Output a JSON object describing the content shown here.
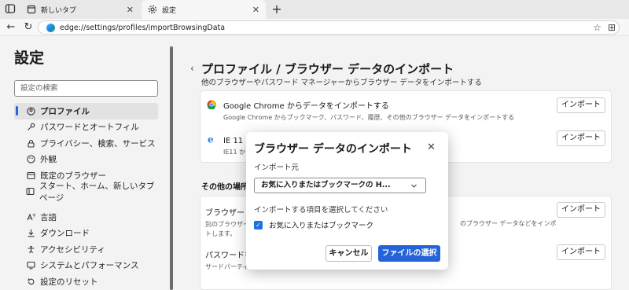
{
  "browser": {
    "tabs": [
      {
        "label": "新しいタブ",
        "icon": "page-icon"
      },
      {
        "label": "設定",
        "icon": "gear-icon"
      }
    ],
    "address": "edge://settings/profiles/importBrowsingData"
  },
  "sidebar": {
    "title": "設定",
    "search_placeholder": "設定の検索",
    "items": [
      {
        "label": "プロファイル",
        "icon": "profile-icon"
      },
      {
        "label": "パスワードとオートフィル",
        "icon": "key-icon"
      },
      {
        "label": "プライバシー、検索、サービス",
        "icon": "lock-icon"
      },
      {
        "label": "外観",
        "icon": "appearance-icon"
      },
      {
        "label": "既定のブラウザー",
        "icon": "browser-icon"
      },
      {
        "label": "スタート、ホーム、新しいタブ ページ",
        "icon": "home-icon"
      },
      {
        "label": "言語",
        "icon": "language-icon"
      },
      {
        "label": "ダウンロード",
        "icon": "download-icon"
      },
      {
        "label": "アクセシビリティ",
        "icon": "accessibility-icon"
      },
      {
        "label": "システムとパフォーマンス",
        "icon": "system-icon"
      },
      {
        "label": "設定のリセット",
        "icon": "reset-icon"
      }
    ]
  },
  "main": {
    "title": "プロファイル / ブラウザー データのインポート",
    "subtitle": "他のブラウザーやパスワード マネージャーからブラウザー データをインポートする",
    "chrome_title": "Google Chrome からデータをインポートする",
    "chrome_desc": "Google Chrome からブックマーク、パスワード、履歴、その他のブラウザー データをインポートする",
    "ie_title": "IE 11 か",
    "ie_desc": "IE11 か",
    "other_section": "その他の場所か",
    "browser_row_title": "ブラウザー デ",
    "browser_row_desc_1": "別のブラウザー",
    "browser_row_desc_2": "トします。",
    "browser_row_desc_right": "のブラウザー データなどをインポ",
    "password_row_title": "パスワードを",
    "password_row_desc": "サードパーティ",
    "import_label": "インポート"
  },
  "modal": {
    "title": "ブラウザー データのインポート",
    "source_label": "インポート元",
    "source_value": "お気に入りまたはブックマークの H...",
    "items_label": "インポートする項目を選択してください",
    "checkbox_label": "お気に入りまたはブックマーク",
    "checkbox_checked": true,
    "cancel": "キャンセル",
    "choose_file": "ファイルの選択"
  },
  "colors": {
    "accent": "#2463d9",
    "sidebar_bg": "#f3f3f3",
    "card_bg": "#ffffff"
  }
}
